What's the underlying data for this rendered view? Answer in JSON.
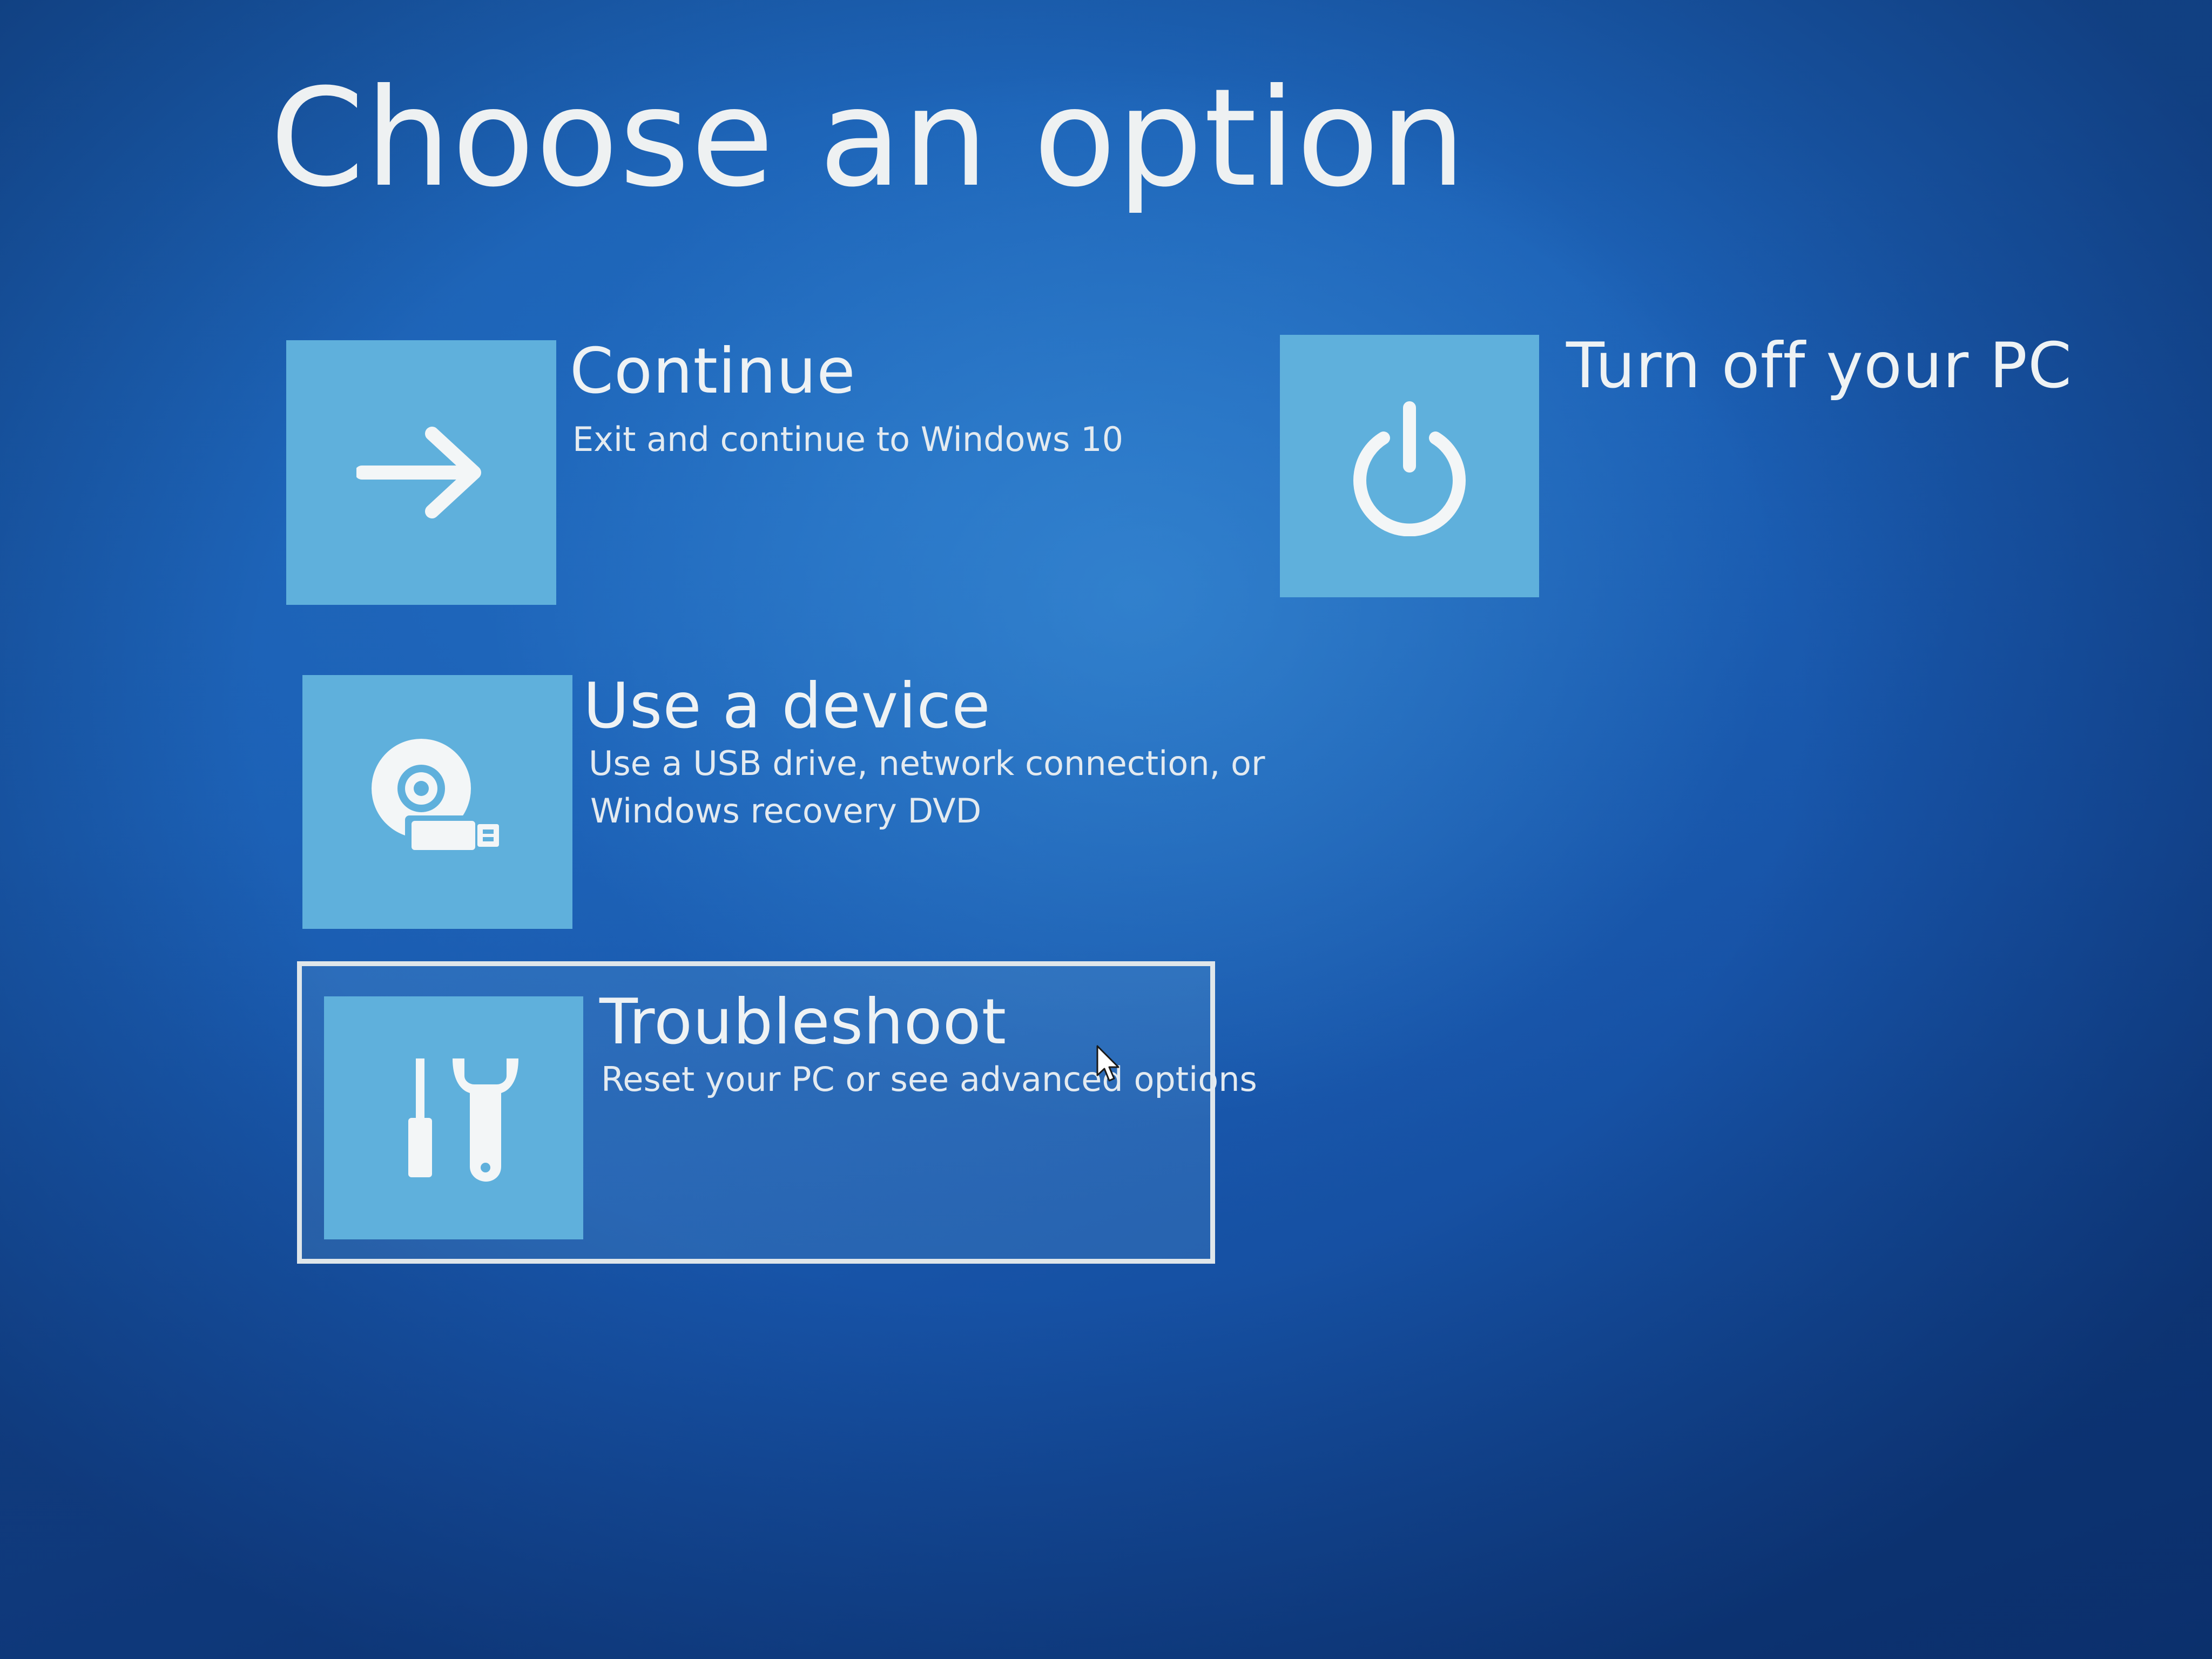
{
  "page": {
    "title": "Choose an option"
  },
  "options": [
    {
      "label": "Continue",
      "description": "Exit and continue to Windows 10",
      "icon": "arrow-right-icon"
    },
    {
      "label": "Use a device",
      "description_line1": "Use a USB drive, network connection, or",
      "description_line2": "Windows recovery DVD",
      "icon": "disc-usb-icon"
    },
    {
      "label": "Troubleshoot",
      "description": "Reset your PC or see advanced options",
      "icon": "tools-icon",
      "selected": true
    },
    {
      "label": "Turn off your PC",
      "icon": "power-icon"
    }
  ],
  "colors": {
    "background": "#1b5fb4",
    "tile": "#5fb0dc",
    "text": "#eef2f4",
    "selection_border": "#dfe6ea"
  }
}
